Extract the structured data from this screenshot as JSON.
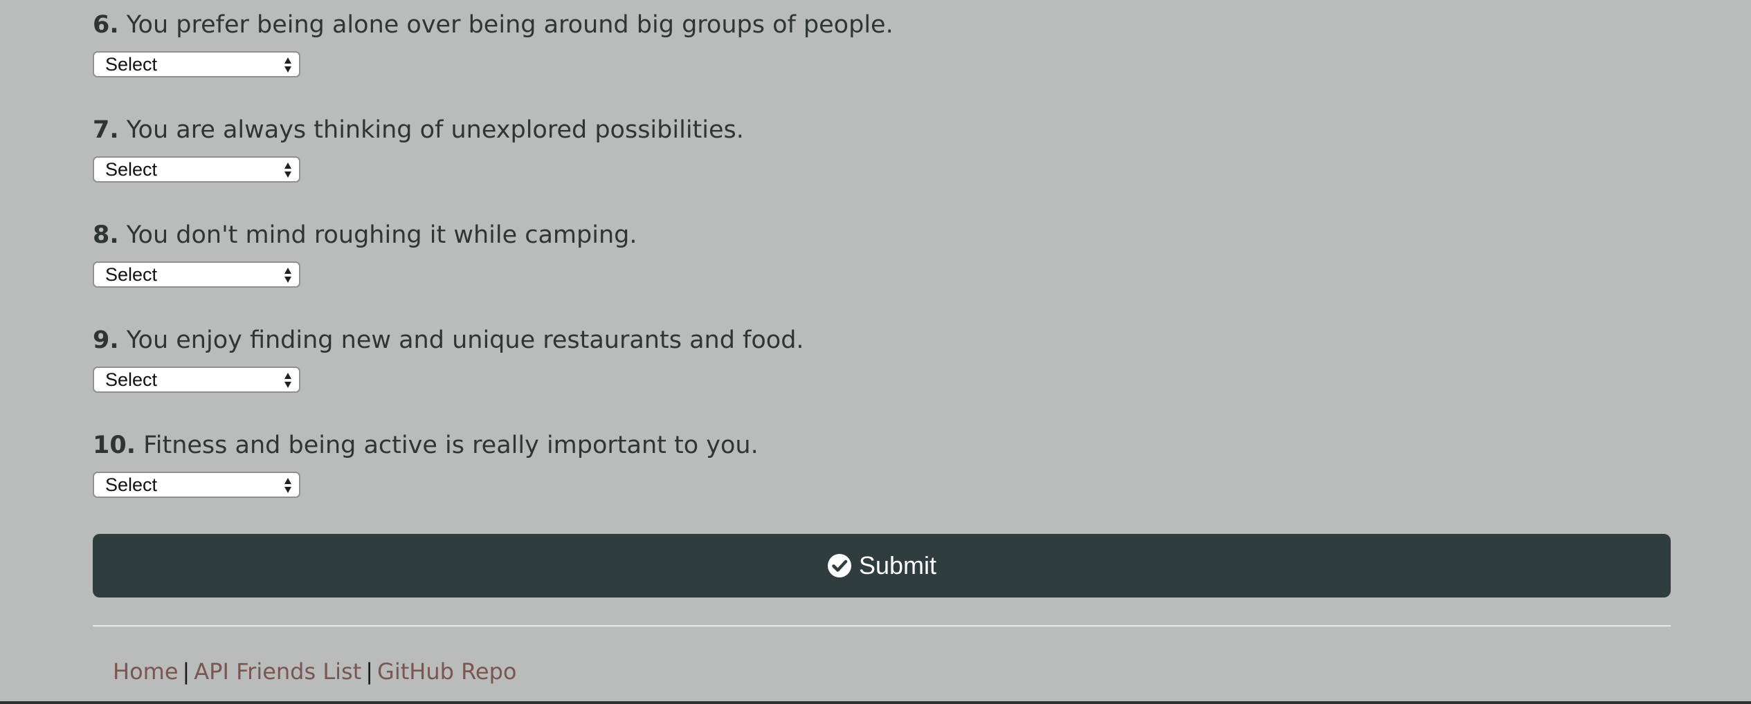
{
  "questions": [
    {
      "number": "6.",
      "text": "You prefer being alone over being around big groups of people.",
      "select_value": "Select"
    },
    {
      "number": "7.",
      "text": "You are always thinking of unexplored possibilities.",
      "select_value": "Select"
    },
    {
      "number": "8.",
      "text": "You don't mind roughing it while camping.",
      "select_value": "Select"
    },
    {
      "number": "9.",
      "text": "You enjoy finding new and unique restaurants and food.",
      "select_value": "Select"
    },
    {
      "number": "10.",
      "text": "Fitness and being active is really important to you.",
      "select_value": "Select"
    }
  ],
  "submit": {
    "label": "Submit",
    "icon": "check-circle-icon"
  },
  "footer": {
    "links": [
      "Home",
      "API Friends List",
      "GitHub Repo"
    ],
    "separator": "|"
  },
  "colors": {
    "background": "#b9bcbb",
    "button": "#303d3e",
    "link": "#7a5650"
  }
}
